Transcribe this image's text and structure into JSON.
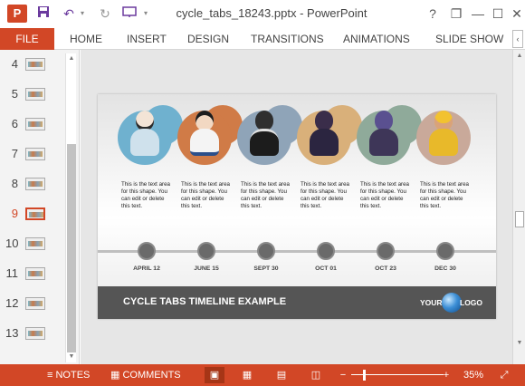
{
  "app": {
    "title": "cycle_tabs_18243.pptx - PowerPoint",
    "logo_letter": "P",
    "qa_icons": [
      "save-icon",
      "undo-icon",
      "redo-icon",
      "slideshow-start-icon",
      "customize-icon"
    ],
    "window_icons": [
      "?",
      "❐",
      "—",
      "☐",
      "✕"
    ]
  },
  "ribbon": {
    "file": "FILE",
    "tabs": [
      "HOME",
      "INSERT",
      "DESIGN",
      "TRANSITIONS",
      "ANIMATIONS",
      "SLIDE SHOW"
    ],
    "collapse": "‹"
  },
  "slides": {
    "numbers": [
      "4",
      "5",
      "6",
      "7",
      "8",
      "9",
      "10",
      "11",
      "12",
      "13"
    ],
    "active_number": "9"
  },
  "slide": {
    "slots": [
      {
        "text": "This is the text area for this shape. You can edit or delete this text.",
        "date": "APRIL 12",
        "color": "#6fb1cf",
        "head": "#f3e4d6",
        "body": "#cfe1ec"
      },
      {
        "text": "This is the text area for this shape. You can edit or delete this text.",
        "date": "JUNE 15",
        "color": "#d07b47",
        "head": "#f2d8c2",
        "body": "#f4f4f4"
      },
      {
        "text": "This is the text area for this shape. You can edit or delete this text.",
        "date": "SEPT 30",
        "color": "#8fa4b8",
        "head": "#2f2f2f",
        "body": "#1c1c1c"
      },
      {
        "text": "This is the text area for this shape. You can edit or delete this text.",
        "date": "OCT 01",
        "color": "#d9b07a",
        "head": "#3a2d4a",
        "body": "#2b2540"
      },
      {
        "text": "This is the text area for this shape. You can edit or delete this text.",
        "date": "OCT 23",
        "color": "#8faa9a",
        "head": "#5a5090",
        "body": "#3e3658"
      },
      {
        "text": "This is the text area for this shape. You can edit or delete this text.",
        "date": "DEC 30",
        "color": "#c9a99a",
        "head": "#f2c230",
        "body": "#e8b92a"
      }
    ],
    "footer_title": "CYCLE TABS TIMELINE EXAMPLE",
    "logo_left": "YOUR",
    "logo_right": "LOGO"
  },
  "statusbar": {
    "notes": "NOTES",
    "comments": "COMMENTS",
    "zoom_minus": "−",
    "zoom_plus": "+",
    "zoom_level": "35%",
    "zoom_fraction": 0.35
  }
}
